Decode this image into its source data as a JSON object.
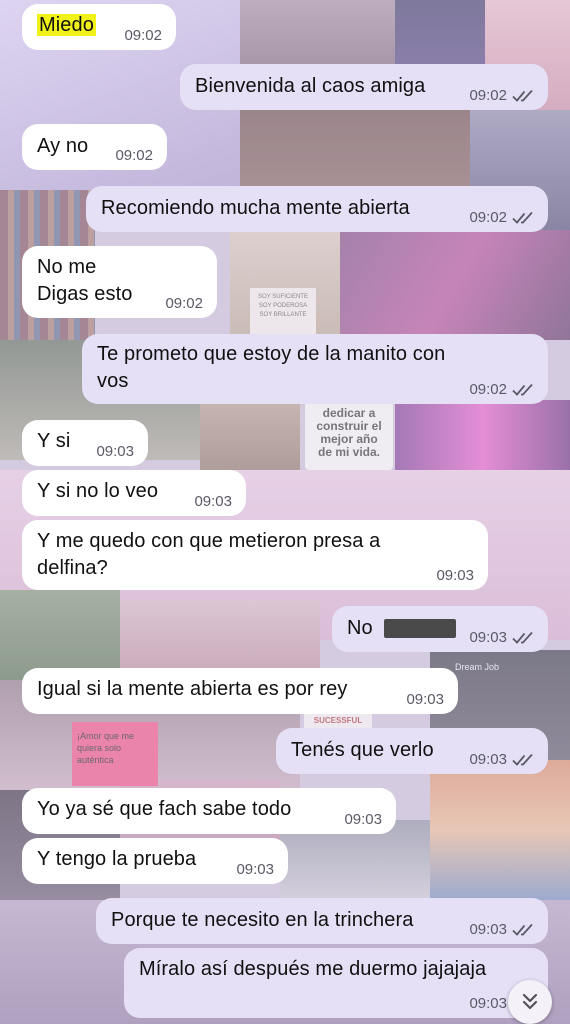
{
  "chat": {
    "messages": [
      {
        "id": "m1",
        "dir": "in",
        "text": "Miedo",
        "time": "09:02",
        "highlighted": true
      },
      {
        "id": "m2",
        "dir": "out",
        "text": "Bienvenida al caos amiga",
        "time": "09:02",
        "status": "read"
      },
      {
        "id": "m3",
        "dir": "in",
        "text": "Ay no",
        "time": "09:02"
      },
      {
        "id": "m4",
        "dir": "out",
        "text": "Recomiendo mucha mente abierta",
        "time": "09:02",
        "status": "read"
      },
      {
        "id": "m5",
        "dir": "in",
        "text": "No me\nDigas esto",
        "time": "09:02"
      },
      {
        "id": "m6",
        "dir": "out",
        "text": "Te prometo que estoy de la manito con\nvos",
        "time": "09:02",
        "status": "read"
      },
      {
        "id": "m7",
        "dir": "in",
        "text": "Y si",
        "time": "09:03"
      },
      {
        "id": "m8",
        "dir": "in",
        "text": "Y si no lo veo",
        "time": "09:03"
      },
      {
        "id": "m9",
        "dir": "in",
        "text": "Y me quedo con que metieron presa a\ndelfina?",
        "time": "09:03"
      },
      {
        "id": "m10",
        "dir": "out",
        "text": "No",
        "time": "09:03",
        "status": "read",
        "redacted": true
      },
      {
        "id": "m11",
        "dir": "in",
        "text": "Igual si la mente abierta es por rey",
        "time": "09:03"
      },
      {
        "id": "m12",
        "dir": "out",
        "text": "Tenés que verlo",
        "time": "09:03",
        "status": "read"
      },
      {
        "id": "m13",
        "dir": "in",
        "text": "Yo ya sé que fach sabe todo",
        "time": "09:03"
      },
      {
        "id": "m14",
        "dir": "in",
        "text": "Y tengo la prueba",
        "time": "09:03"
      },
      {
        "id": "m15",
        "dir": "out",
        "text": "Porque te necesito en la trinchera",
        "time": "09:03",
        "status": "read"
      },
      {
        "id": "m16",
        "dir": "out",
        "text": "Míralo así después me duermo jajajaja",
        "time": "09:03",
        "status": "read"
      }
    ]
  },
  "wallpaper": {
    "texts": {
      "poster_left": "SOY SUFICIENTE\nSOY PODEROSA\nSOY BRILLANTE",
      "poster_mid": "dedicar a\nconstruir el\nmejor año\nde mi vida.",
      "pink_note": "¡Amor que me\nquiera solo\nauténtica",
      "dream_job": "Dream Job",
      "sucessful": "SUCESSFUL"
    }
  },
  "colors": {
    "incoming_bubble": "#ffffff",
    "outgoing_bubble": "#e5e0f6",
    "read_ticks": "#5a5a66",
    "highlight": "#f0f21a"
  },
  "icons": {
    "read_receipt": "double-check-icon",
    "scroll_down": "double-chevron-down-icon"
  }
}
